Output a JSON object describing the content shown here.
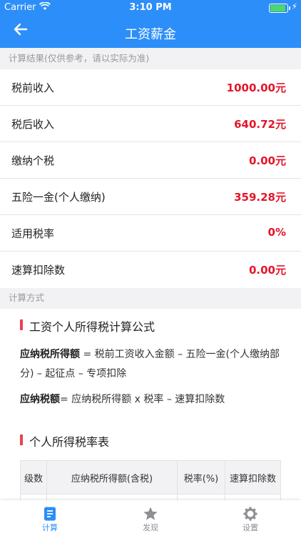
{
  "status": {
    "carrier": "Carrier",
    "time": "3:10 PM"
  },
  "nav": {
    "title": "工资薪金"
  },
  "result": {
    "section_title": "计算结果(仅供参考，请以实际为准)",
    "rows": [
      {
        "label": "税前收入",
        "value": "1000.00元"
      },
      {
        "label": "税后收入",
        "value": "640.72元"
      },
      {
        "label": "缴纳个税",
        "value": "0.00元"
      },
      {
        "label": "五险一金(个人缴纳)",
        "value": "359.28元"
      },
      {
        "label": "适用税率",
        "value": "0%"
      },
      {
        "label": "速算扣除数",
        "value": "0.00元"
      }
    ]
  },
  "method": {
    "section_title": "计算方式",
    "formula_title": "工资个人所得税计算公式",
    "formula1_term": "应纳税所得额",
    "formula1_rest": " = 税前工资收入金额 – 五险一金(个人缴纳部分) – 起征点 – 专项扣除",
    "formula2_term": "应纳税额",
    "formula2_rest": "= 应纳税所得额 x 税率 – 速算扣除数",
    "table_title": "个人所得税率表",
    "table_headers": [
      "级数",
      "应纳税所得额(含税)",
      "税率(%)",
      "速算扣除数"
    ]
  },
  "tabs": [
    {
      "label": "计算",
      "icon": "calculator-icon",
      "active": true
    },
    {
      "label": "发现",
      "icon": "star-icon",
      "active": false
    },
    {
      "label": "设置",
      "icon": "gear-icon",
      "active": false
    }
  ],
  "colors": {
    "primary": "#2c8ef8",
    "value_red": "#e4162a",
    "accent_bar": "#e8424f"
  }
}
